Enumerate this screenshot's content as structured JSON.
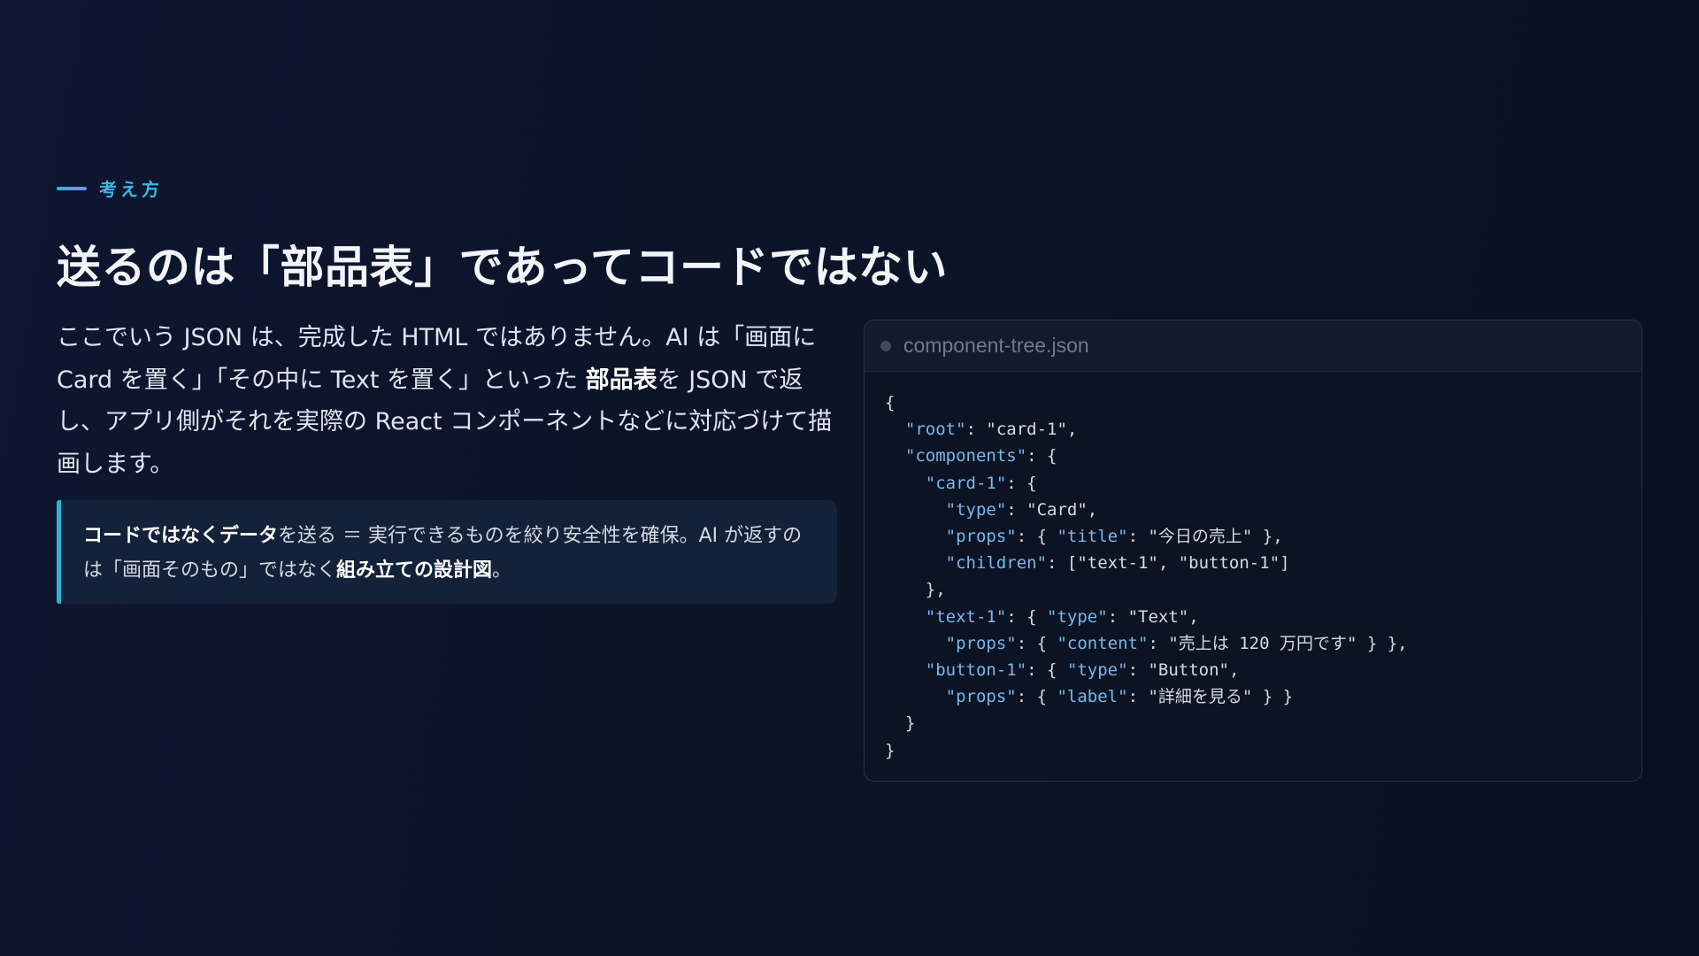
{
  "eyebrow": {
    "label": "考え方"
  },
  "title": "送るのは「部品表」であってコードではない",
  "body": {
    "part1": "ここでいう JSON は、完成した HTML ではありません。AI は「画面に Card を置く」「その中に Text を置く」といった ",
    "strong": "部品表",
    "part2": "を JSON で返し、アプリ側がそれを実際の React コンポーネントなどに対応づけて描画します。"
  },
  "callout": {
    "strong1": "コードではなくデータ",
    "part1": "を送る ＝ 実行できるものを絞り安全性を確保。AI が返すのは「画面そのもの」ではなく",
    "strong2": "組み立ての設計図",
    "part2": "。"
  },
  "code_panel": {
    "filename": "component-tree.json",
    "lines": [
      "{",
      "  \"root\": \"card-1\",",
      "  \"components\": {",
      "    \"card-1\": {",
      "      \"type\": \"Card\",",
      "      \"props\": { \"title\": \"今日の売上\" },",
      "      \"children\": [\"text-1\", \"button-1\"]",
      "    },",
      "    \"text-1\": { \"type\": \"Text\",",
      "      \"props\": { \"content\": \"売上は 120 万円です\" } },",
      "    \"button-1\": { \"type\": \"Button\",",
      "      \"props\": { \"label\": \"詳細を見る\" } }",
      "  }",
      "}"
    ]
  },
  "colors": {
    "accent": "#3fb6e4",
    "background": "#0c1429",
    "code_key": "#76b8f0"
  }
}
